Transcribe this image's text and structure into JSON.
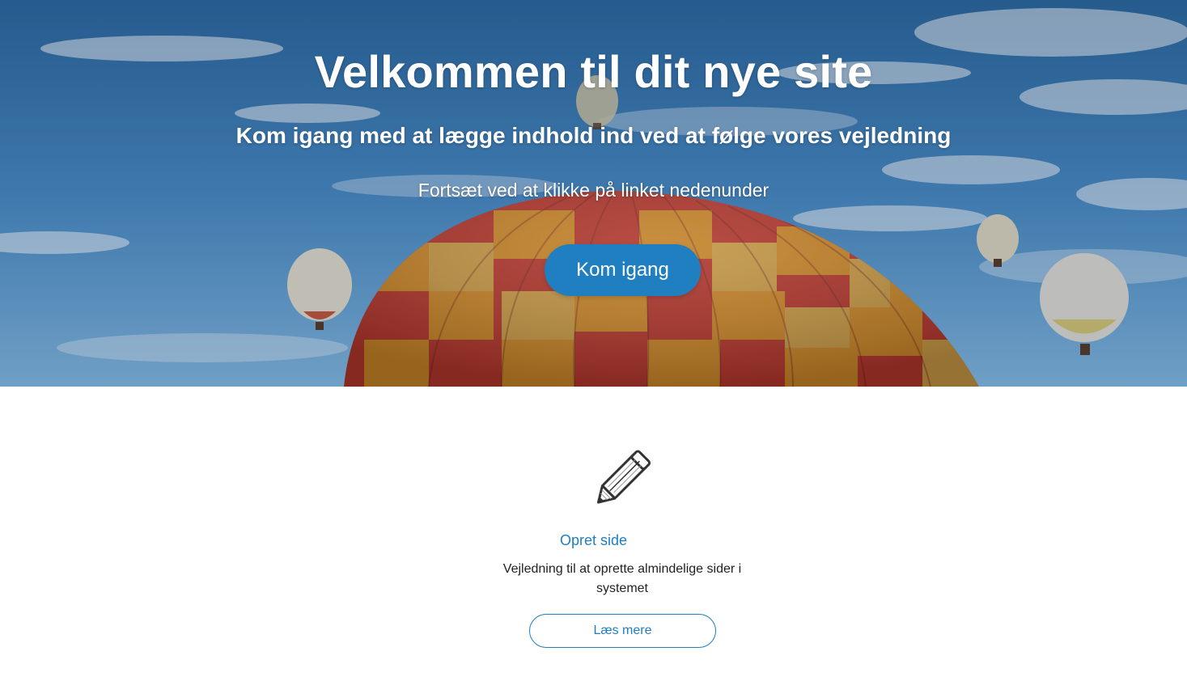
{
  "hero": {
    "title": "Velkommen til dit nye site",
    "subtitle": "Kom igang med at lægge indhold ind ved at følge vores vejledning",
    "text": "Fortsæt ved at klikke på linket nedenunder",
    "button_label": "Kom igang",
    "background_image": "hot-air-balloons-sky"
  },
  "feature": {
    "icon": "pencil-icon",
    "title": "Opret side",
    "description": "Vejledning til at oprette almindelige sider i systemet",
    "button_label": "Læs mere"
  },
  "colors": {
    "accent": "#1f7fc0",
    "hero_text": "#ffffff",
    "body_text": "#222222"
  }
}
